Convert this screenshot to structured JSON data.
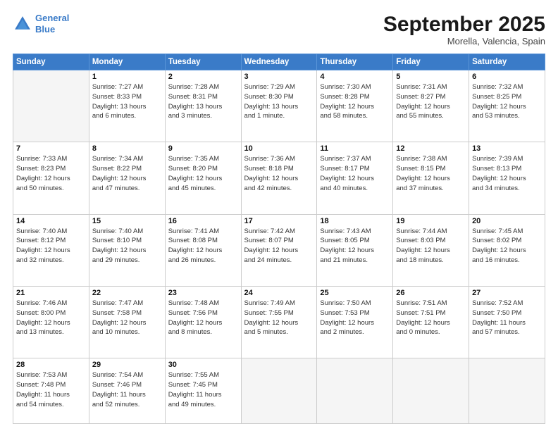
{
  "header": {
    "logo_line1": "General",
    "logo_line2": "Blue",
    "month": "September 2025",
    "location": "Morella, Valencia, Spain"
  },
  "weekdays": [
    "Sunday",
    "Monday",
    "Tuesday",
    "Wednesday",
    "Thursday",
    "Friday",
    "Saturday"
  ],
  "weeks": [
    [
      {
        "day": "",
        "info": ""
      },
      {
        "day": "1",
        "info": "Sunrise: 7:27 AM\nSunset: 8:33 PM\nDaylight: 13 hours\nand 6 minutes."
      },
      {
        "day": "2",
        "info": "Sunrise: 7:28 AM\nSunset: 8:31 PM\nDaylight: 13 hours\nand 3 minutes."
      },
      {
        "day": "3",
        "info": "Sunrise: 7:29 AM\nSunset: 8:30 PM\nDaylight: 13 hours\nand 1 minute."
      },
      {
        "day": "4",
        "info": "Sunrise: 7:30 AM\nSunset: 8:28 PM\nDaylight: 12 hours\nand 58 minutes."
      },
      {
        "day": "5",
        "info": "Sunrise: 7:31 AM\nSunset: 8:27 PM\nDaylight: 12 hours\nand 55 minutes."
      },
      {
        "day": "6",
        "info": "Sunrise: 7:32 AM\nSunset: 8:25 PM\nDaylight: 12 hours\nand 53 minutes."
      }
    ],
    [
      {
        "day": "7",
        "info": "Sunrise: 7:33 AM\nSunset: 8:23 PM\nDaylight: 12 hours\nand 50 minutes."
      },
      {
        "day": "8",
        "info": "Sunrise: 7:34 AM\nSunset: 8:22 PM\nDaylight: 12 hours\nand 47 minutes."
      },
      {
        "day": "9",
        "info": "Sunrise: 7:35 AM\nSunset: 8:20 PM\nDaylight: 12 hours\nand 45 minutes."
      },
      {
        "day": "10",
        "info": "Sunrise: 7:36 AM\nSunset: 8:18 PM\nDaylight: 12 hours\nand 42 minutes."
      },
      {
        "day": "11",
        "info": "Sunrise: 7:37 AM\nSunset: 8:17 PM\nDaylight: 12 hours\nand 40 minutes."
      },
      {
        "day": "12",
        "info": "Sunrise: 7:38 AM\nSunset: 8:15 PM\nDaylight: 12 hours\nand 37 minutes."
      },
      {
        "day": "13",
        "info": "Sunrise: 7:39 AM\nSunset: 8:13 PM\nDaylight: 12 hours\nand 34 minutes."
      }
    ],
    [
      {
        "day": "14",
        "info": "Sunrise: 7:40 AM\nSunset: 8:12 PM\nDaylight: 12 hours\nand 32 minutes."
      },
      {
        "day": "15",
        "info": "Sunrise: 7:40 AM\nSunset: 8:10 PM\nDaylight: 12 hours\nand 29 minutes."
      },
      {
        "day": "16",
        "info": "Sunrise: 7:41 AM\nSunset: 8:08 PM\nDaylight: 12 hours\nand 26 minutes."
      },
      {
        "day": "17",
        "info": "Sunrise: 7:42 AM\nSunset: 8:07 PM\nDaylight: 12 hours\nand 24 minutes."
      },
      {
        "day": "18",
        "info": "Sunrise: 7:43 AM\nSunset: 8:05 PM\nDaylight: 12 hours\nand 21 minutes."
      },
      {
        "day": "19",
        "info": "Sunrise: 7:44 AM\nSunset: 8:03 PM\nDaylight: 12 hours\nand 18 minutes."
      },
      {
        "day": "20",
        "info": "Sunrise: 7:45 AM\nSunset: 8:02 PM\nDaylight: 12 hours\nand 16 minutes."
      }
    ],
    [
      {
        "day": "21",
        "info": "Sunrise: 7:46 AM\nSunset: 8:00 PM\nDaylight: 12 hours\nand 13 minutes."
      },
      {
        "day": "22",
        "info": "Sunrise: 7:47 AM\nSunset: 7:58 PM\nDaylight: 12 hours\nand 10 minutes."
      },
      {
        "day": "23",
        "info": "Sunrise: 7:48 AM\nSunset: 7:56 PM\nDaylight: 12 hours\nand 8 minutes."
      },
      {
        "day": "24",
        "info": "Sunrise: 7:49 AM\nSunset: 7:55 PM\nDaylight: 12 hours\nand 5 minutes."
      },
      {
        "day": "25",
        "info": "Sunrise: 7:50 AM\nSunset: 7:53 PM\nDaylight: 12 hours\nand 2 minutes."
      },
      {
        "day": "26",
        "info": "Sunrise: 7:51 AM\nSunset: 7:51 PM\nDaylight: 12 hours\nand 0 minutes."
      },
      {
        "day": "27",
        "info": "Sunrise: 7:52 AM\nSunset: 7:50 PM\nDaylight: 11 hours\nand 57 minutes."
      }
    ],
    [
      {
        "day": "28",
        "info": "Sunrise: 7:53 AM\nSunset: 7:48 PM\nDaylight: 11 hours\nand 54 minutes."
      },
      {
        "day": "29",
        "info": "Sunrise: 7:54 AM\nSunset: 7:46 PM\nDaylight: 11 hours\nand 52 minutes."
      },
      {
        "day": "30",
        "info": "Sunrise: 7:55 AM\nSunset: 7:45 PM\nDaylight: 11 hours\nand 49 minutes."
      },
      {
        "day": "",
        "info": ""
      },
      {
        "day": "",
        "info": ""
      },
      {
        "day": "",
        "info": ""
      },
      {
        "day": "",
        "info": ""
      }
    ]
  ]
}
